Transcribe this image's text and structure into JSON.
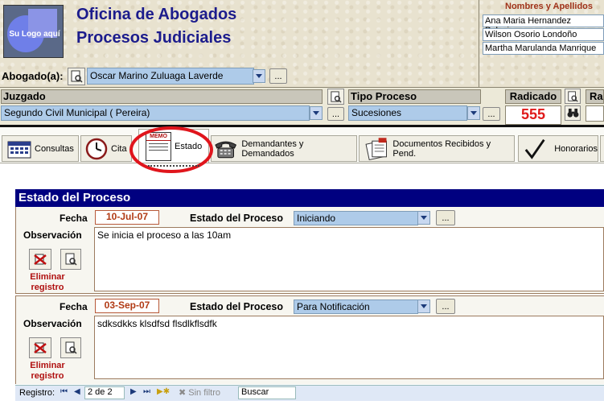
{
  "header": {
    "logo_text": "Su Logo aquí",
    "title_line1": "Oficina de Abogados",
    "title_line2": "Procesos Judiciales",
    "names_header": "Nombres y Apellidos",
    "names": [
      "Ana Maria Hernandez Palacio",
      "Wilson Osorio Londoño",
      "Martha Marulanda Manrique"
    ]
  },
  "abogado": {
    "label": "Abogado(a):",
    "value": "Oscar Marino Zuluaga Laverde",
    "more_label": "..."
  },
  "juzgado": {
    "label": "Juzgado",
    "value": "Segundo Civil Municipal  ( Pereira)",
    "more_label": "..."
  },
  "tipo_proceso": {
    "label": "Tipo Proceso",
    "value": "Sucesiones",
    "more_label": "..."
  },
  "radicado": {
    "label": "Radicado",
    "value": "555",
    "next_label": "Ra"
  },
  "tabs": [
    {
      "label": "Consultas",
      "icon": "calendar-icon"
    },
    {
      "label": "Cita",
      "icon": "clock-icon"
    },
    {
      "label": "Estado",
      "icon": "memo-icon",
      "memo_text": "MEMO"
    },
    {
      "label": "Demandantes y Demandados",
      "icon": "phone-icon"
    },
    {
      "label": "Documentos Recibidos y Pend.",
      "icon": "documents-icon"
    },
    {
      "label": "Honorarios",
      "icon": "checkmark-icon"
    }
  ],
  "section_title": "Estado del Proceso",
  "records": [
    {
      "fecha_label": "Fecha",
      "fecha": "10-Jul-07",
      "estado_label": "Estado del Proceso",
      "estado": "Iniciando",
      "obs_label": "Observación",
      "observacion": "Se inicia el proceso a las 10am",
      "delete_label_1": "Eliminar",
      "delete_label_2": "registro",
      "more_label": "..."
    },
    {
      "fecha_label": "Fecha",
      "fecha": "03-Sep-07",
      "estado_label": "Estado del Proceso",
      "estado": "Para Notificación",
      "obs_label": "Observación",
      "observacion": "sdksdkks klsdfsd flsdlkflsdfk",
      "delete_label_1": "Eliminar",
      "delete_label_2": "registro",
      "more_label": "..."
    }
  ],
  "navigator": {
    "label": "Registro:",
    "position": "2 de 2",
    "filter_label": "Sin filtro",
    "search_label": "Buscar"
  },
  "colors": {
    "title_blue": "#1c1c8c",
    "section_navy": "#000080",
    "radicado_red": "#e01b1b",
    "highlight_circle": "#e0151c"
  }
}
